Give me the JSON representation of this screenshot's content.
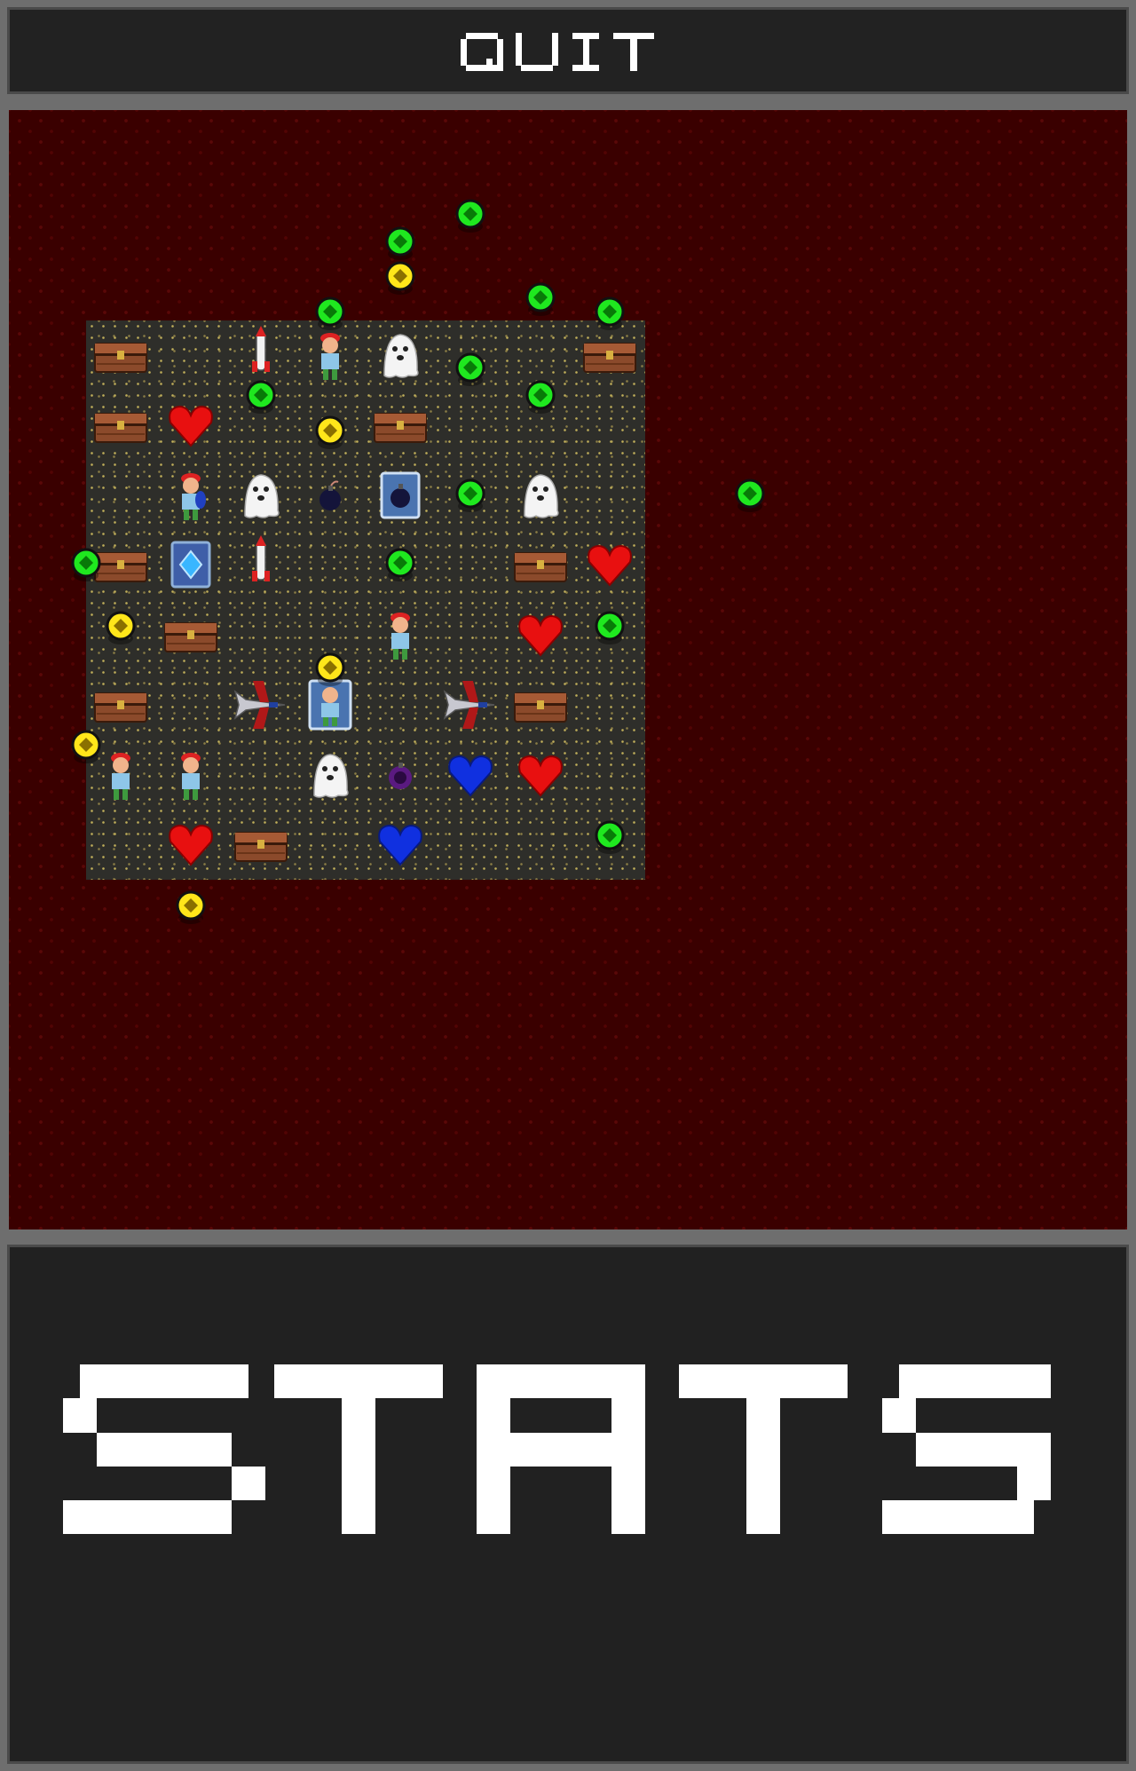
{
  "quit": {
    "label": "QUIT"
  },
  "stats": {
    "label": "STATS"
  },
  "colors": {
    "background": "#3a0000",
    "board": "#2e2e2a",
    "panel": "#212121",
    "frame": "#6e6e6e",
    "gem_green": "#1fe81f",
    "gem_yellow": "#ffe61a",
    "heart_red": "#e81010",
    "heart_blue": "#1030e0"
  },
  "board": {
    "columns": 8,
    "rows": 8,
    "cells": [
      {
        "row": 0,
        "col": 0,
        "item": "treasure-chest"
      },
      {
        "row": 0,
        "col": 2,
        "item": "rocket"
      },
      {
        "row": 0,
        "col": 3,
        "item": "red-cap-boy"
      },
      {
        "row": 0,
        "col": 4,
        "item": "ghost"
      },
      {
        "row": 0,
        "col": 7,
        "item": "treasure-chest"
      },
      {
        "row": 1,
        "col": 0,
        "item": "treasure-chest"
      },
      {
        "row": 1,
        "col": 1,
        "item": "red-heart"
      },
      {
        "row": 1,
        "col": 4,
        "item": "treasure-chest"
      },
      {
        "row": 2,
        "col": 1,
        "item": "blue-shield-boy"
      },
      {
        "row": 2,
        "col": 2,
        "item": "ghost"
      },
      {
        "row": 2,
        "col": 3,
        "item": "bomb"
      },
      {
        "row": 2,
        "col": 4,
        "item": "bomb-card"
      },
      {
        "row": 2,
        "col": 6,
        "item": "ghost"
      },
      {
        "row": 3,
        "col": 0,
        "item": "treasure-chest"
      },
      {
        "row": 3,
        "col": 1,
        "item": "blue-gem-card"
      },
      {
        "row": 3,
        "col": 2,
        "item": "rocket"
      },
      {
        "row": 3,
        "col": 6,
        "item": "treasure-chest"
      },
      {
        "row": 3,
        "col": 7,
        "item": "red-heart"
      },
      {
        "row": 4,
        "col": 1,
        "item": "treasure-chest"
      },
      {
        "row": 4,
        "col": 4,
        "item": "red-cap-boy"
      },
      {
        "row": 4,
        "col": 6,
        "item": "red-heart"
      },
      {
        "row": 5,
        "col": 0,
        "item": "treasure-chest"
      },
      {
        "row": 5,
        "col": 2,
        "item": "fighter-jet"
      },
      {
        "row": 5,
        "col": 3,
        "item": "boy-card"
      },
      {
        "row": 5,
        "col": 5,
        "item": "fighter-jet"
      },
      {
        "row": 5,
        "col": 6,
        "item": "treasure-chest"
      },
      {
        "row": 6,
        "col": 0,
        "item": "red-cap-boy"
      },
      {
        "row": 6,
        "col": 1,
        "item": "red-cap-boy"
      },
      {
        "row": 6,
        "col": 3,
        "item": "ghost"
      },
      {
        "row": 6,
        "col": 4,
        "item": "purple-bomb"
      },
      {
        "row": 6,
        "col": 5,
        "item": "blue-heart"
      },
      {
        "row": 6,
        "col": 6,
        "item": "red-heart"
      },
      {
        "row": 7,
        "col": 1,
        "item": "red-heart"
      },
      {
        "row": 7,
        "col": 2,
        "item": "treasure-chest"
      },
      {
        "row": 7,
        "col": 4,
        "item": "blue-heart"
      }
    ]
  },
  "pickups": [
    {
      "type": "green-gem",
      "row": -2,
      "col": 5
    },
    {
      "type": "green-gem",
      "row": -1.6,
      "col": 4
    },
    {
      "type": "yellow-gem",
      "row": -1.1,
      "col": 4
    },
    {
      "type": "green-gem",
      "row": -0.8,
      "col": 6
    },
    {
      "type": "green-gem",
      "row": -0.6,
      "col": 3
    },
    {
      "type": "green-gem",
      "row": -0.6,
      "col": 7
    },
    {
      "type": "green-gem",
      "row": 0.2,
      "col": 5
    },
    {
      "type": "green-gem",
      "row": 0.6,
      "col": 2
    },
    {
      "type": "green-gem",
      "row": 0.6,
      "col": 6
    },
    {
      "type": "yellow-gem",
      "row": 1.1,
      "col": 3
    },
    {
      "type": "green-gem",
      "row": 2,
      "col": 5
    },
    {
      "type": "green-gem",
      "row": 2,
      "col": 9
    },
    {
      "type": "green-gem",
      "row": 3,
      "col": -0.5
    },
    {
      "type": "green-gem",
      "row": 3,
      "col": 4
    },
    {
      "type": "yellow-gem",
      "row": 3.9,
      "col": 0
    },
    {
      "type": "green-gem",
      "row": 3.9,
      "col": 7
    },
    {
      "type": "yellow-gem",
      "row": 4.5,
      "col": 3
    },
    {
      "type": "yellow-gem",
      "row": 5.6,
      "col": -0.5
    },
    {
      "type": "green-gem",
      "row": 6.9,
      "col": 7
    },
    {
      "type": "yellow-gem",
      "row": 7.9,
      "col": 1
    }
  ]
}
